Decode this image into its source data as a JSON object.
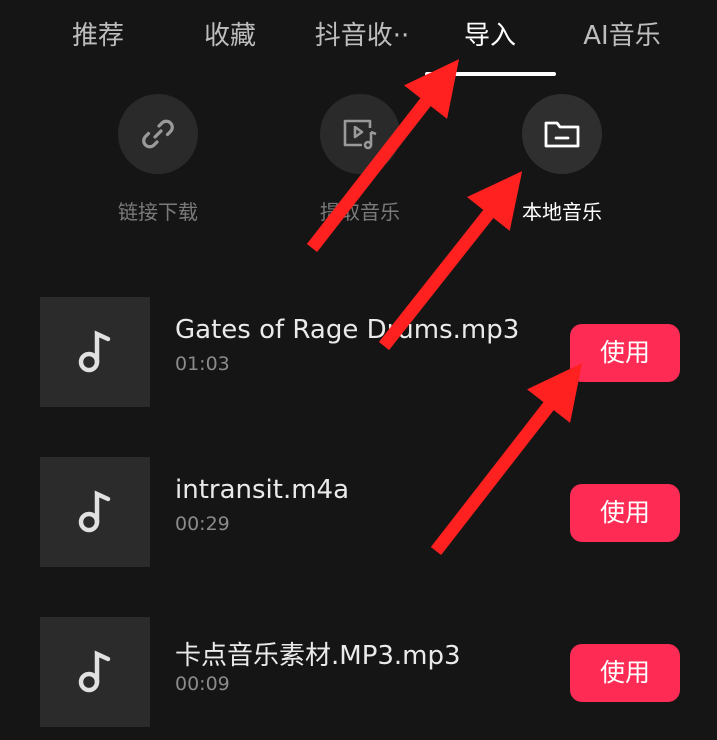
{
  "tabs": [
    {
      "label": "推荐"
    },
    {
      "label": "收藏"
    },
    {
      "label": "抖音收··"
    },
    {
      "label": "导入"
    },
    {
      "label": "AI音乐"
    }
  ],
  "active_tab": "导入",
  "import_options": [
    {
      "label": "链接下载",
      "icon": "link-icon"
    },
    {
      "label": "提取音乐",
      "icon": "video-music-icon"
    },
    {
      "label": "本地音乐",
      "icon": "folder-icon"
    }
  ],
  "tracks": [
    {
      "title": "Gates of Rage Drums.mp3",
      "duration": "01:03",
      "action": "使用"
    },
    {
      "title": "intransit.m4a",
      "duration": "00:29",
      "action": "使用"
    },
    {
      "title": "卡点音乐素材.MP3.mp3",
      "duration": "00:09",
      "action": "使用"
    }
  ],
  "colors": {
    "background": "#151515",
    "accent": "#fe2c55",
    "annotation_arrow": "#ff2020"
  }
}
